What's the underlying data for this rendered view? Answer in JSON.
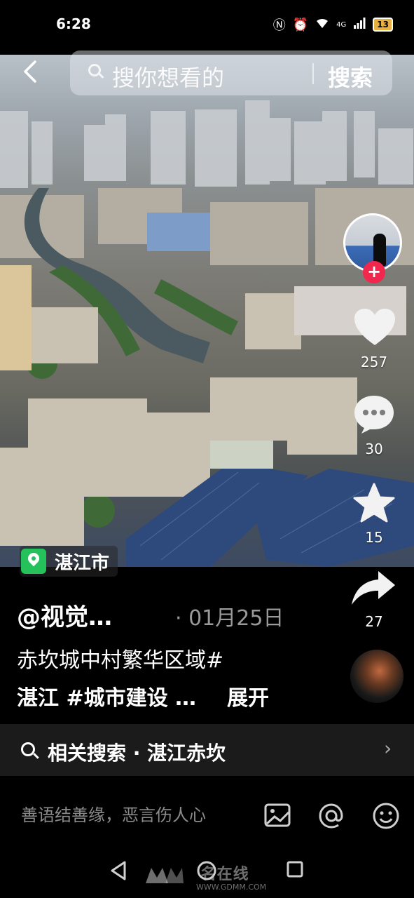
{
  "status_bar": {
    "time": "6:28",
    "network": "4G",
    "battery": "13"
  },
  "search": {
    "placeholder": "搜你想看的",
    "button": "搜索"
  },
  "location": {
    "label": "湛江市"
  },
  "actions": {
    "likes": "257",
    "comments": "30",
    "favorites": "15",
    "shares": "27"
  },
  "post": {
    "author": "@视觉…",
    "date": "· 01月25日",
    "description_line1": "赤坎城中村繁华区域#",
    "description_line2": "湛江 #城市建设 …",
    "expand": "展开"
  },
  "related_search": {
    "text": "相关搜索 · 湛江赤坎"
  },
  "comment_bar": {
    "placeholder": "善语结善缘，恶言伤人心"
  },
  "watermark": {
    "text": "名在线",
    "url": "WWW.GDMM.COM"
  }
}
